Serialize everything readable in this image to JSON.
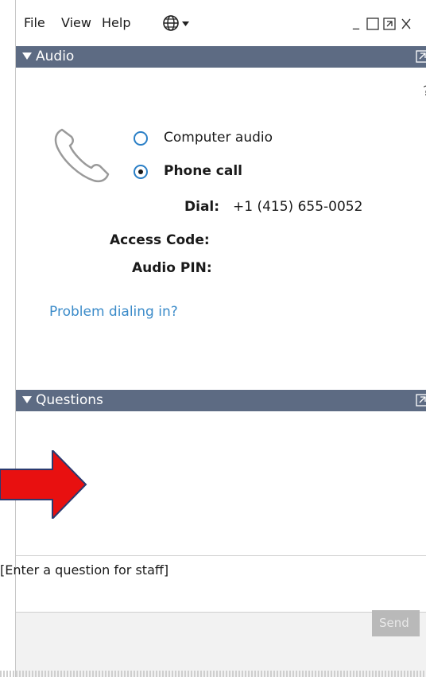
{
  "menu": {
    "file": "File",
    "view": "View",
    "help": "Help"
  },
  "window_controls": {
    "minimize": "_"
  },
  "audio": {
    "header": "Audio",
    "help_mark": "?",
    "options": [
      {
        "label": "Computer audio",
        "selected": false
      },
      {
        "label": "Phone call",
        "selected": true
      }
    ],
    "dial_label": "Dial:",
    "dial_value": "+1 (415) 655-0052",
    "access_code_label": "Access Code:",
    "audio_pin_label": "Audio PIN:",
    "problem_link": "Problem dialing in?"
  },
  "questions": {
    "header": "Questions",
    "input_placeholder": "[Enter a question for staff]",
    "send_label": "Send"
  },
  "colors": {
    "header_bg": "#5d6b83",
    "radio_accent": "#2a7fc6",
    "link": "#3b8bc9",
    "arrow": "#e81010"
  },
  "icons": [
    "globe-icon",
    "chevron-down-icon",
    "minimize-icon",
    "maximize-icon",
    "popout-icon",
    "close-icon",
    "collapse-triangle-icon",
    "expand-icon",
    "phone-icon",
    "red-arrow-icon"
  ]
}
